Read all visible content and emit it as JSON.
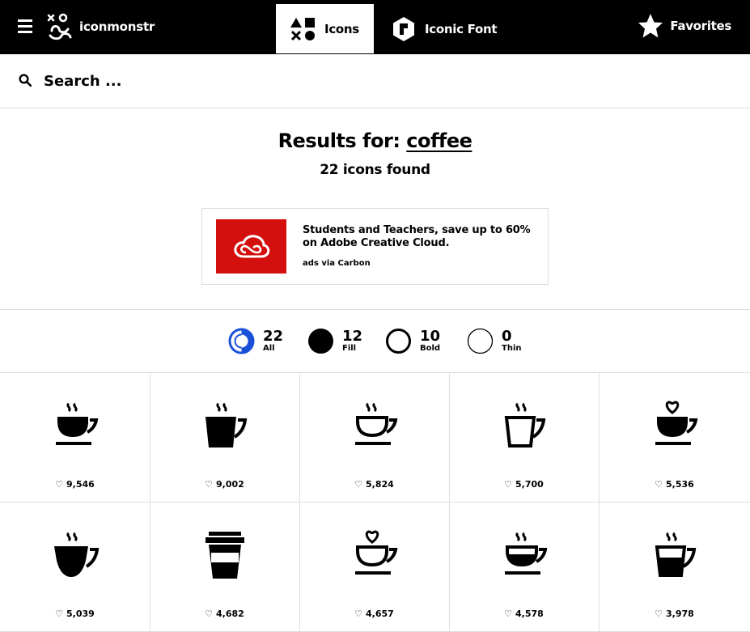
{
  "brand": {
    "name": "iconmonstr"
  },
  "nav": {
    "icons_label": "Icons",
    "iconic_font_label": "Iconic Font",
    "favorites_label": "Favorites"
  },
  "search": {
    "placeholder": "Search ..."
  },
  "results": {
    "prefix": "Results for: ",
    "query": "coffee",
    "count_text": "22 icons found"
  },
  "ad": {
    "text": "Students and Teachers, save up to 60% on Adobe Creative Cloud.",
    "via": "ads via Carbon"
  },
  "colors": {
    "accent": "#1a4fd8",
    "ad_bg": "#d4100e",
    "border": "#dddddd"
  },
  "filters": [
    {
      "count": "22",
      "label": "All",
      "icon": "half-circle-icon"
    },
    {
      "count": "12",
      "label": "Fill",
      "icon": "filled-circle-icon"
    },
    {
      "count": "10",
      "label": "Bold",
      "icon": "bold-circle-icon"
    },
    {
      "count": "0",
      "label": "Thin",
      "icon": "thin-circle-icon"
    }
  ],
  "icons": [
    {
      "name": "coffee-cup-steam-fill",
      "likes": "9,546"
    },
    {
      "name": "coffee-mug-steam-fill",
      "likes": "9,002"
    },
    {
      "name": "coffee-cup-steam-outline",
      "likes": "5,824"
    },
    {
      "name": "coffee-mug-steam-outline",
      "likes": "5,700"
    },
    {
      "name": "coffee-cup-heart-fill",
      "likes": "5,536"
    },
    {
      "name": "coffee-bowl-steam-fill",
      "likes": "5,039"
    },
    {
      "name": "takeaway-cup",
      "likes": "4,682"
    },
    {
      "name": "coffee-cup-heart-outline",
      "likes": "4,657"
    },
    {
      "name": "coffee-cup-half-fill",
      "likes": "4,578"
    },
    {
      "name": "coffee-mug-half-fill",
      "likes": "3,978"
    }
  ]
}
